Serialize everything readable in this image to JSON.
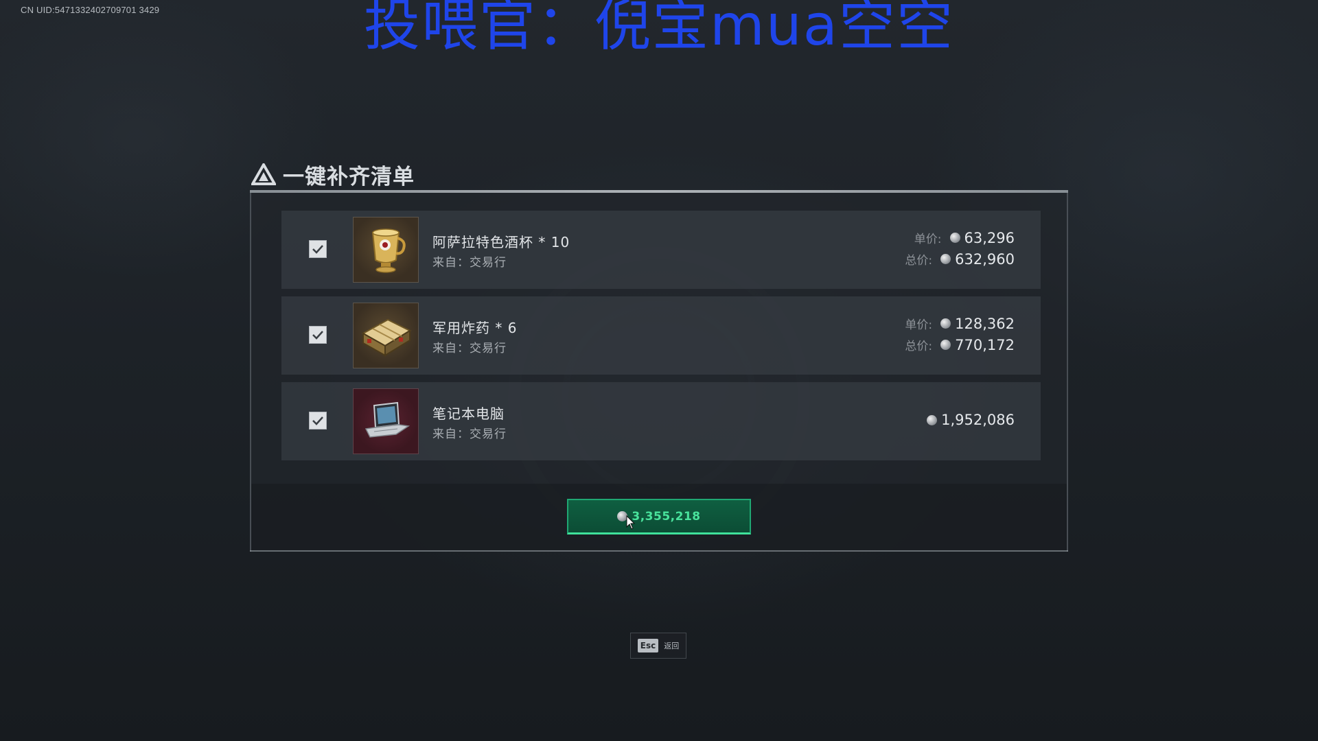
{
  "uid_text": "CN UID:5471332402709701 3429",
  "banner_text": "投喂官：倪宝mua空空",
  "panel": {
    "title": "一键补齐清单"
  },
  "items": [
    {
      "name": "阿萨拉特色酒杯 * 10",
      "source": "来自：交易行",
      "unit_label": "单价:",
      "unit_price": "63,296",
      "total_label": "总价:",
      "total_price": "632,960",
      "checked": true,
      "icon": "cup-icon"
    },
    {
      "name": "军用炸药 * 6",
      "source": "来自：交易行",
      "unit_label": "单价:",
      "unit_price": "128,362",
      "total_label": "总价:",
      "total_price": "770,172",
      "checked": true,
      "icon": "explosive-icon"
    },
    {
      "name": "笔记本电脑",
      "source": "来自：交易行",
      "price": "1,952,086",
      "checked": true,
      "icon": "laptop-icon"
    }
  ],
  "confirm": {
    "amount": "3,355,218"
  },
  "esc": {
    "key": "Esc",
    "label": "返回"
  },
  "colors": {
    "banner": "#1f45ea",
    "confirm_accent": "#49e39c",
    "confirm_bg": "#0f5f41"
  }
}
